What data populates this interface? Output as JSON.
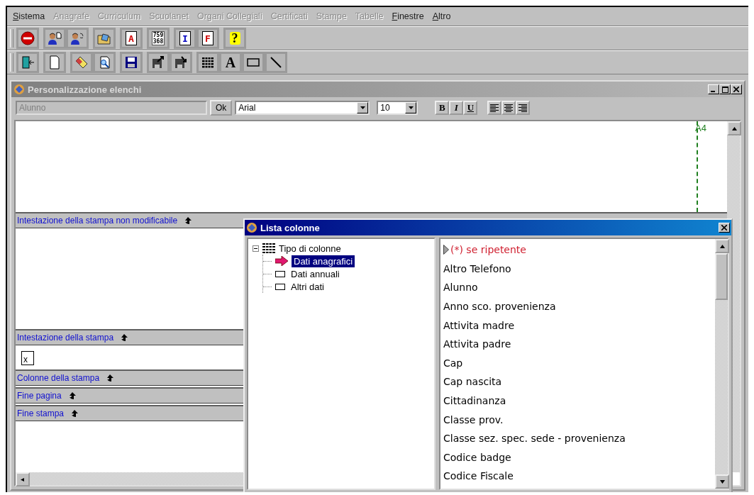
{
  "menu": [
    {
      "label": "Sistema",
      "disabled": false
    },
    {
      "label": "Anagrafe",
      "disabled": true
    },
    {
      "label": "Curriculum",
      "disabled": true
    },
    {
      "label": "Scuolanet",
      "disabled": true
    },
    {
      "label": "Organi Collegiali",
      "disabled": true
    },
    {
      "label": "Certificati",
      "disabled": true
    },
    {
      "label": "Stampe",
      "disabled": true
    },
    {
      "label": "Tabelle",
      "disabled": true
    },
    {
      "label": "Finestre",
      "disabled": false
    },
    {
      "label": "Altro",
      "disabled": false
    }
  ],
  "toolbars": [
    [
      [
        {
          "kind": "stop"
        }
      ],
      [
        {
          "kind": "person-doc"
        },
        {
          "kind": "person-refresh"
        }
      ],
      [
        {
          "kind": "folder"
        }
      ],
      [
        {
          "kind": "letter-doc",
          "glyph": "A",
          "color": "#d00000"
        }
      ],
      [
        {
          "kind": "digits",
          "glyph_lines": [
            "759",
            "368"
          ]
        }
      ],
      [
        {
          "kind": "letter-doc",
          "glyph": "I",
          "color": "#0000c0"
        },
        {
          "kind": "letter-doc",
          "glyph": "F",
          "color": "#d00000"
        }
      ],
      [
        {
          "kind": "help",
          "glyph": "?"
        }
      ]
    ],
    [
      [
        {
          "kind": "exit"
        }
      ],
      [
        {
          "kind": "new"
        }
      ],
      [
        {
          "kind": "eraser"
        },
        {
          "kind": "preview"
        }
      ],
      [
        {
          "kind": "save"
        }
      ],
      [
        {
          "kind": "export"
        },
        {
          "kind": "import"
        }
      ],
      [
        {
          "kind": "grid"
        },
        {
          "kind": "text",
          "glyph": "A"
        },
        {
          "kind": "rect"
        },
        {
          "kind": "line"
        }
      ]
    ]
  ],
  "window": {
    "title": "Personalizzazione elenchi"
  },
  "format_bar": {
    "field": {
      "value": "Alunno",
      "disabled": true
    },
    "ok_button": "Ok",
    "font": "Arial",
    "size": "10",
    "style_buttons": [
      {
        "label": "B",
        "kind": "bold"
      },
      {
        "label": "I",
        "kind": "italic"
      },
      {
        "label": "U",
        "kind": "underline"
      }
    ]
  },
  "page": {
    "size_label": "A4"
  },
  "bands": [
    {
      "title": "Intestazione della stampa non modificabile",
      "kind": "tall"
    },
    {
      "title": "Intestazione della stampa",
      "kind": "field",
      "field_value": "x"
    },
    {
      "title": "Colonne della stampa",
      "kind": "bar"
    },
    {
      "title": "Fine pagina",
      "kind": "bar"
    },
    {
      "title": "Fine stampa",
      "kind": "fill"
    }
  ],
  "dialog": {
    "title": "Lista colonne",
    "tree": {
      "label": "Tipo di colonne",
      "expanded": true,
      "children": [
        {
          "label": "Dati anagrafici",
          "selected": true
        },
        {
          "label": "Dati annuali",
          "selected": false
        },
        {
          "label": "Altri dati",
          "selected": false
        }
      ]
    },
    "columns": [
      {
        "label": "(*) se ripetente",
        "kind": "note"
      },
      {
        "label": "Altro Telefono",
        "kind": "field"
      },
      {
        "label": "Alunno",
        "kind": "field"
      },
      {
        "label": "Anno sco. provenienza",
        "kind": "field"
      },
      {
        "label": "Attivita madre",
        "kind": "field"
      },
      {
        "label": "Attivita padre",
        "kind": "field"
      },
      {
        "label": "Cap",
        "kind": "field"
      },
      {
        "label": "Cap nascita",
        "kind": "field"
      },
      {
        "label": "Cittadinanza",
        "kind": "field"
      },
      {
        "label": "Classe prov.",
        "kind": "field"
      },
      {
        "label": "Classe sez. spec. sede - provenienza",
        "kind": "field"
      },
      {
        "label": "Codice badge",
        "kind": "field"
      },
      {
        "label": "Codice Fiscale",
        "kind": "field"
      }
    ]
  }
}
